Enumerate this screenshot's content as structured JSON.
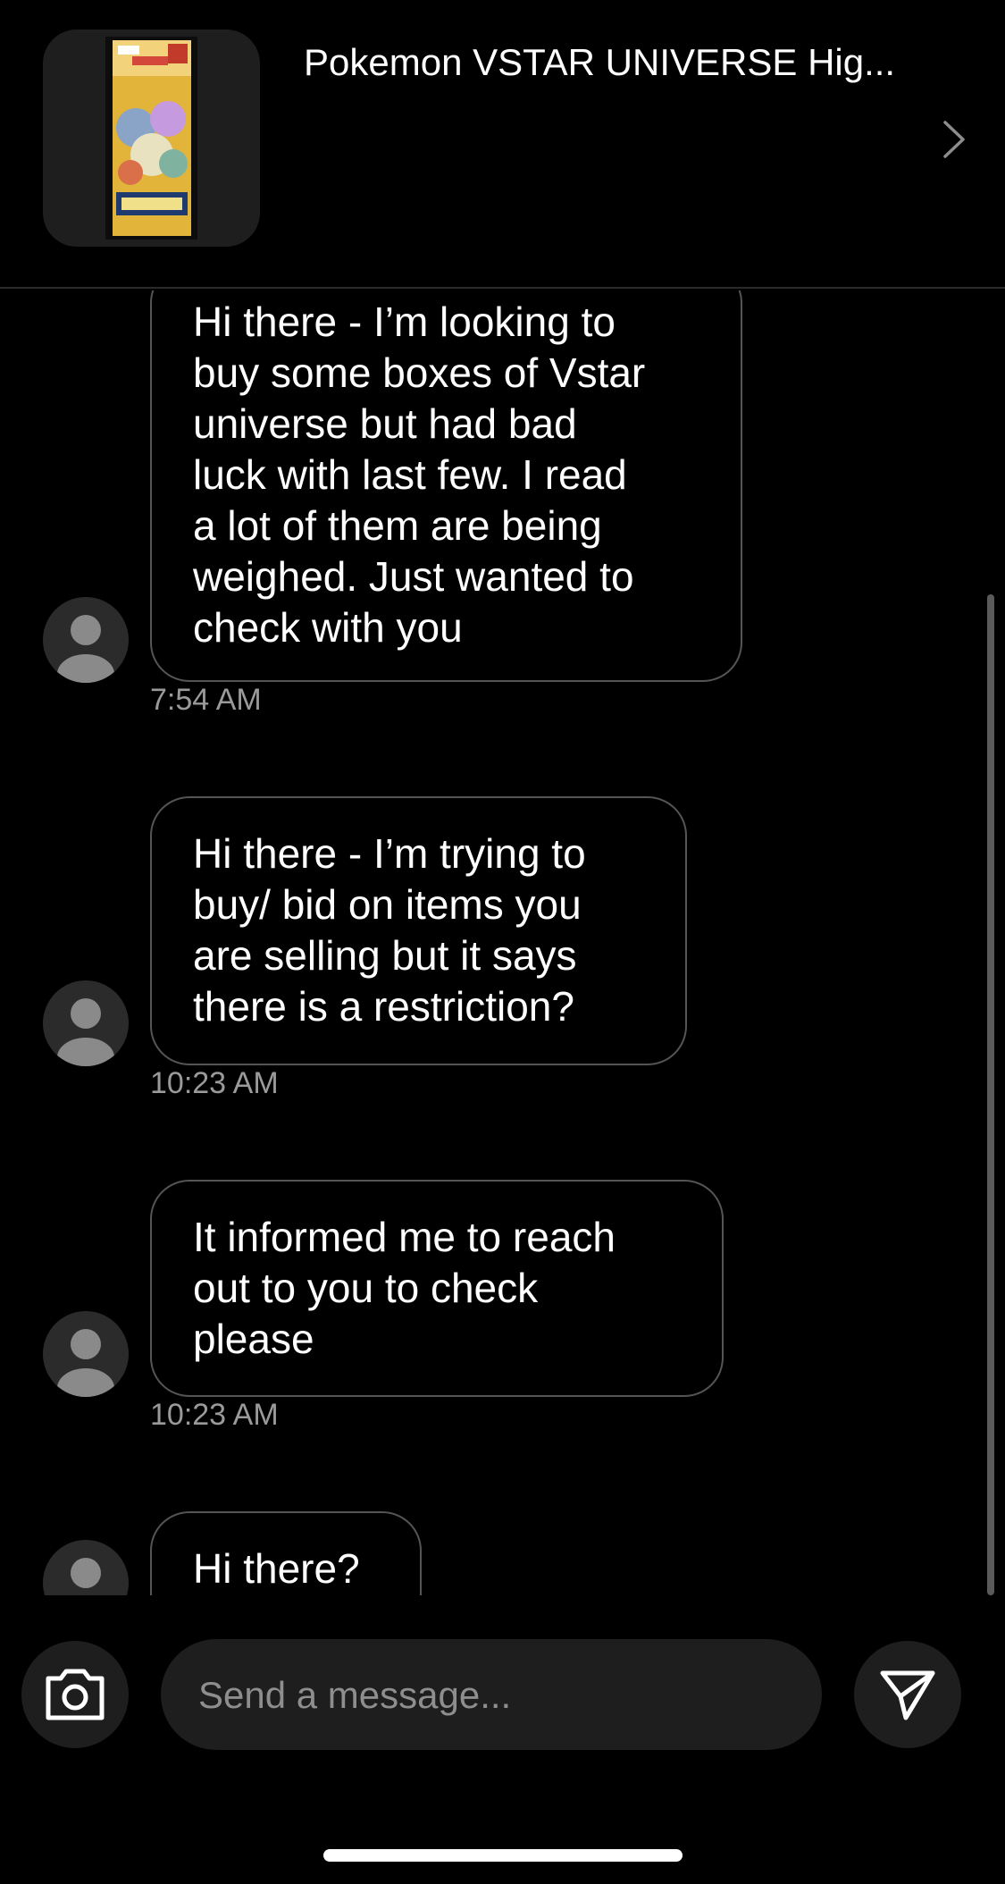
{
  "header": {
    "listing_title": "Pokemon VSTAR UNIVERSE Hig...",
    "thumbnail_icon": "pokemon-vstar-universe-box-image",
    "chevron_icon": "chevron-right-icon"
  },
  "messages": [
    {
      "lines": [
        "Hi there - I’m looking to",
        "buy some boxes of Vstar",
        "universe but had bad",
        "luck with last few. I read",
        "a lot of them are being",
        "weighed. Just wanted to",
        "check with you"
      ],
      "time": "7:54 AM"
    },
    {
      "lines": [
        "Hi there - I’m trying to",
        "buy/ bid on items you",
        "are selling but it says",
        "there is a restriction?"
      ],
      "time": "10:23 AM"
    },
    {
      "lines": [
        "It informed me to reach",
        "out to you to check",
        "please"
      ],
      "time": "10:23 AM"
    },
    {
      "lines": [
        "Hi there?"
      ],
      "time": ""
    }
  ],
  "composer": {
    "placeholder": "Send a message...",
    "value": "",
    "camera_icon": "camera-icon",
    "send_icon": "send-icon"
  },
  "colors": {
    "background": "#000000",
    "bubble_border": "#555555",
    "timestamp": "#9a9a9a",
    "control_bg": "#1e1e1e"
  }
}
